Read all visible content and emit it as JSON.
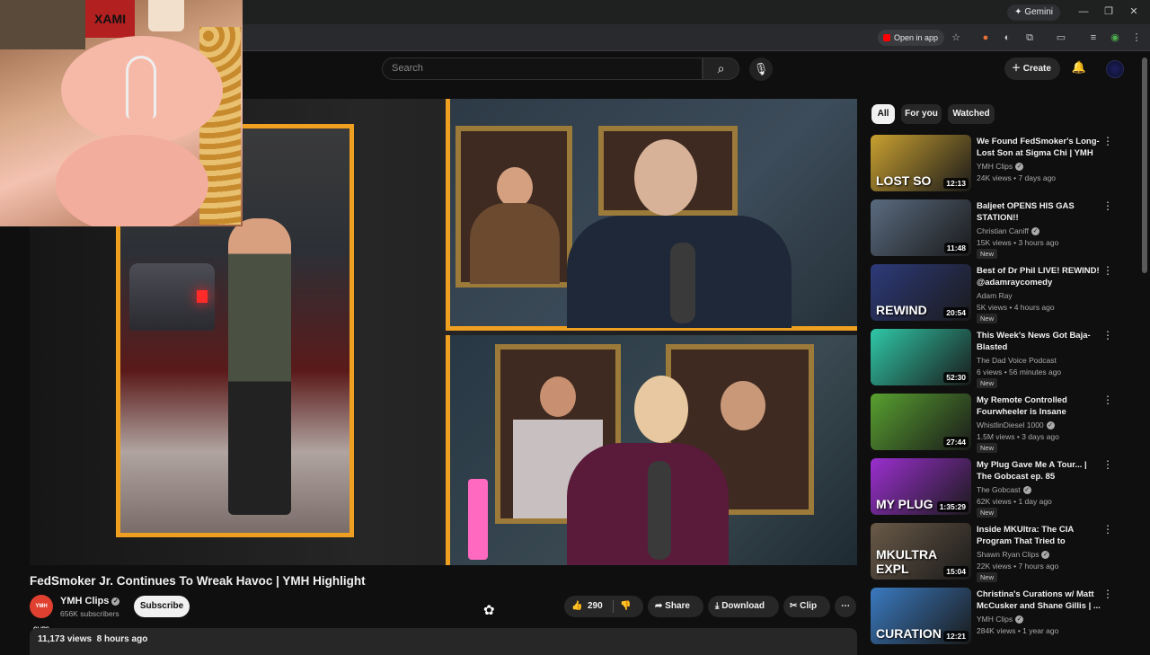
{
  "browser": {
    "gemini_label": "Gemini",
    "open_in_app_label": "Open in app"
  },
  "webcam": {
    "poster_text": "XAMI"
  },
  "header": {
    "search_placeholder": "Search",
    "create_label": "Create"
  },
  "video": {
    "title": "FedSmoker Jr. Continues To Wreak Havoc | YMH Highlight",
    "channel_name": "YMH Clips",
    "channel_avatar_text": "YMH CLIPS",
    "subscribers": "656K subscribers",
    "subscribe_label": "Subscribe",
    "likes": "290",
    "share_label": "Share",
    "download_label": "Download",
    "clip_label": "Clip",
    "views": "11,173 views",
    "age": "8 hours ago"
  },
  "chips": [
    {
      "label": "All",
      "active": true
    },
    {
      "label": "For you",
      "active": false
    },
    {
      "label": "Watched",
      "active": false
    }
  ],
  "recommendations": [
    {
      "title": "We Found FedSmoker's Long-Lost Son at Sigma Chi | YMH ...",
      "channel": "YMH Clips",
      "verified": true,
      "meta": "24K views • 7 days ago",
      "duration": "12:13",
      "new": "",
      "thumb_text": "LOST SO",
      "thumb_color": "#c9a030"
    },
    {
      "title": "Baljeet OPENS HIS GAS STATION!!",
      "channel": "Christian Caniff",
      "verified": true,
      "meta": "15K views • 3 hours ago",
      "duration": "11:48",
      "new": "New",
      "thumb_text": "",
      "thumb_color": "#5a6b80"
    },
    {
      "title": "Best of Dr Phil LIVE! REWIND! @adamraycomedy",
      "channel": "Adam Ray",
      "verified": false,
      "meta": "5K views • 4 hours ago",
      "duration": "20:54",
      "new": "New",
      "thumb_text": "REWIND",
      "thumb_color": "#2d3a7a"
    },
    {
      "title": "This Week's News Got Baja-Blasted",
      "channel": "The Dad Voice Podcast",
      "verified": false,
      "meta": "6 views • 56 minutes ago",
      "duration": "52:30",
      "new": "New",
      "thumb_text": "",
      "thumb_color": "#2fc8a8"
    },
    {
      "title": "My Remote Controlled Fourwheeler is Insane",
      "channel": "WhistlinDiesel 1000",
      "verified": true,
      "meta": "1.5M views • 3 days ago",
      "duration": "27:44",
      "new": "New",
      "thumb_text": "",
      "thumb_color": "#58a030"
    },
    {
      "title": "My Plug Gave Me A Tour... | The Gobcast ep. 85",
      "channel": "The Gobcast",
      "verified": true,
      "meta": "62K views • 1 day ago",
      "duration": "1:35:29",
      "new": "New",
      "thumb_text": "MY PLUG",
      "thumb_color": "#9b2fd0"
    },
    {
      "title": "Inside MKUltra: The CIA Program That Tried to Enginee...",
      "channel": "Shawn Ryan Clips",
      "verified": true,
      "meta": "22K views • 7 hours ago",
      "duration": "15:04",
      "new": "New",
      "thumb_text": "MKULTRA EXPL",
      "thumb_color": "#6a5a48"
    },
    {
      "title": "Christina's Curations w/ Matt McCusker and Shane Gillis | ...",
      "channel": "YMH Clips",
      "verified": true,
      "meta": "284K views • 1 year ago",
      "duration": "12:21",
      "new": "",
      "thumb_text": "CURATION",
      "thumb_color": "#3a7ac0"
    }
  ],
  "colors": {
    "accent_border": "#f0a020",
    "background": "#0f0f0f"
  }
}
